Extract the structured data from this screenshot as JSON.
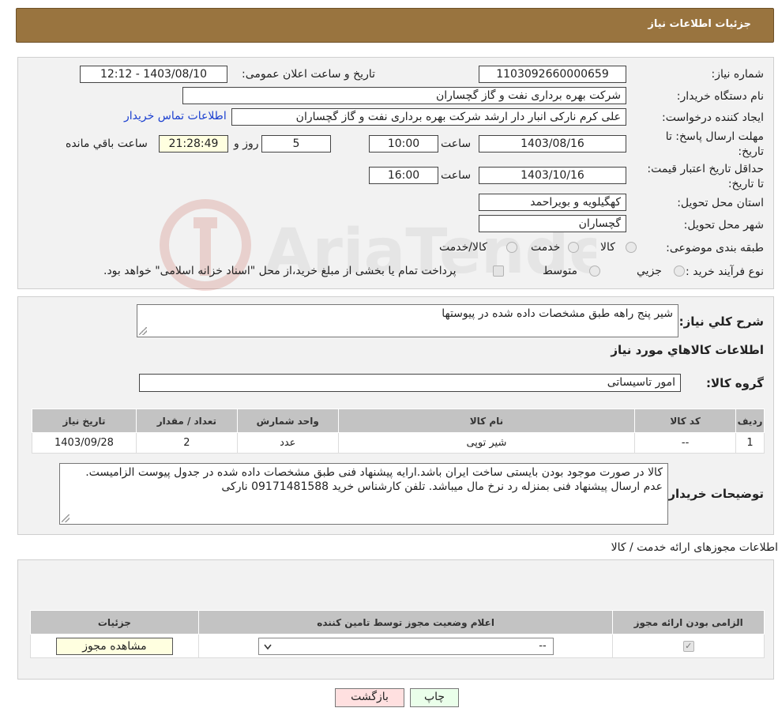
{
  "header": {
    "title": "جزئیات اطلاعات نیاز"
  },
  "form": {
    "need_number": {
      "label": "شماره نیاز:",
      "value": "1103092660000659"
    },
    "announce_datetime": {
      "label": "تاریخ و ساعت اعلان عمومی:",
      "value": "1403/08/10 - 12:12"
    },
    "buyer_org": {
      "label": "نام دستگاه خریدار:",
      "value": "شرکت بهره برداری نفت و گاز گچساران"
    },
    "requester": {
      "label": "ایجاد کننده درخواست:",
      "value": "علی کرم نارکی انبار دار ارشد شرکت بهره برداری نفت و گاز گچساران",
      "contact_link": "اطلاعات تماس خریدار"
    },
    "deadline": {
      "label": "مهلت ارسال پاسخ: تا تاریخ:",
      "date": "1403/08/16",
      "time_label": "ساعت",
      "time": "10:00",
      "days": "5",
      "days_label": "روز و",
      "remaining": "21:28:49",
      "remaining_label": "ساعت باقي مانده"
    },
    "price_validity": {
      "label": "حداقل تاریخ اعتبار قیمت: تا تاریخ:",
      "date": "1403/10/16",
      "time_label": "ساعت",
      "time": "16:00"
    },
    "province": {
      "label": "استان محل تحویل:",
      "value": "کهگیلویه و بویراحمد"
    },
    "city": {
      "label": "شهر محل تحویل:",
      "value": "گچساران"
    },
    "category": {
      "label": "طبقه بندی موضوعی:",
      "options": [
        "کالا",
        "خدمت",
        "کالا/خدمت"
      ]
    },
    "purchase_process": {
      "label": "نوع فرآیند خرید :",
      "options": [
        "جزیي",
        "متوسط"
      ],
      "note": "پرداخت تمام یا بخشی از مبلغ خرید،از محل \"اسناد خزانه اسلامی\" خواهد بود."
    }
  },
  "watermark": {
    "text": "AriaTender.neT"
  },
  "need_desc": {
    "label": "شرح کلي نياز:",
    "value": "شیر پنج راهه طبق مشخصات داده شده در پیوستها"
  },
  "goods_info": {
    "title": "اطلاعات کالاهاي مورد نياز",
    "group_label": "گروه کالا:",
    "group_value": "امور تاسیساتی",
    "columns": [
      "رديف",
      "کد کالا",
      "نام کالا",
      "واحد شمارش",
      "تعداد / مقدار",
      "تاريخ نياز"
    ],
    "rows": [
      {
        "row": "1",
        "code": "--",
        "name": "شیر توپی",
        "unit": "عدد",
        "qty": "2",
        "date": "1403/09/28"
      }
    ]
  },
  "buyer_notes": {
    "label": "توضیحات خریدار:",
    "value": "کالا در صورت موجود بودن بایستی ساخت ایران باشد.ارایه پیشنهاد فنی طبق مشخصات داده شده در جدول پیوست الزامیست. عدم ارسال پیشنهاد فنی بمنزله رد نرخ مال میباشد. تلفن کارشناس خرید 09171481588 نارکی"
  },
  "permits": {
    "title": "اطلاعات مجوزهای ارائه خدمت / کالا",
    "columns": [
      "الزامی بودن ارائه مجوز",
      "اعلام وضعیت مجوز توسط تامین کننده",
      "جزئیات"
    ],
    "row": {
      "select_value": "--",
      "view_button": "مشاهده مجوز"
    }
  },
  "buttons": {
    "print": "چاپ",
    "back": "بازگشت"
  }
}
